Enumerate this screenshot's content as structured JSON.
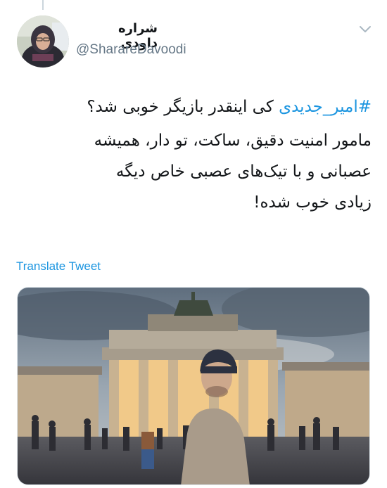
{
  "tweet": {
    "author_name": "شراره داودی",
    "author_handle": "@SharareDavoodi",
    "text_line1_hashtag": "#امیر_جدیدی",
    "text_line1_rest": " کی اینقدر بازیگر خوبی شد؟",
    "text_line2": "مامور امنیت دقیق، ساکت، تو دار، همیشه",
    "text_line3": "عصبانی و با تیک‌های عصبی خاص دیگه",
    "text_line4": "زیادی خوب شده!",
    "translate_label": "Translate Tweet"
  },
  "icons": {
    "menu": "chevron-down-icon"
  },
  "colors": {
    "link": "#1b95e0",
    "text": "#14171a",
    "secondary": "#657786"
  }
}
